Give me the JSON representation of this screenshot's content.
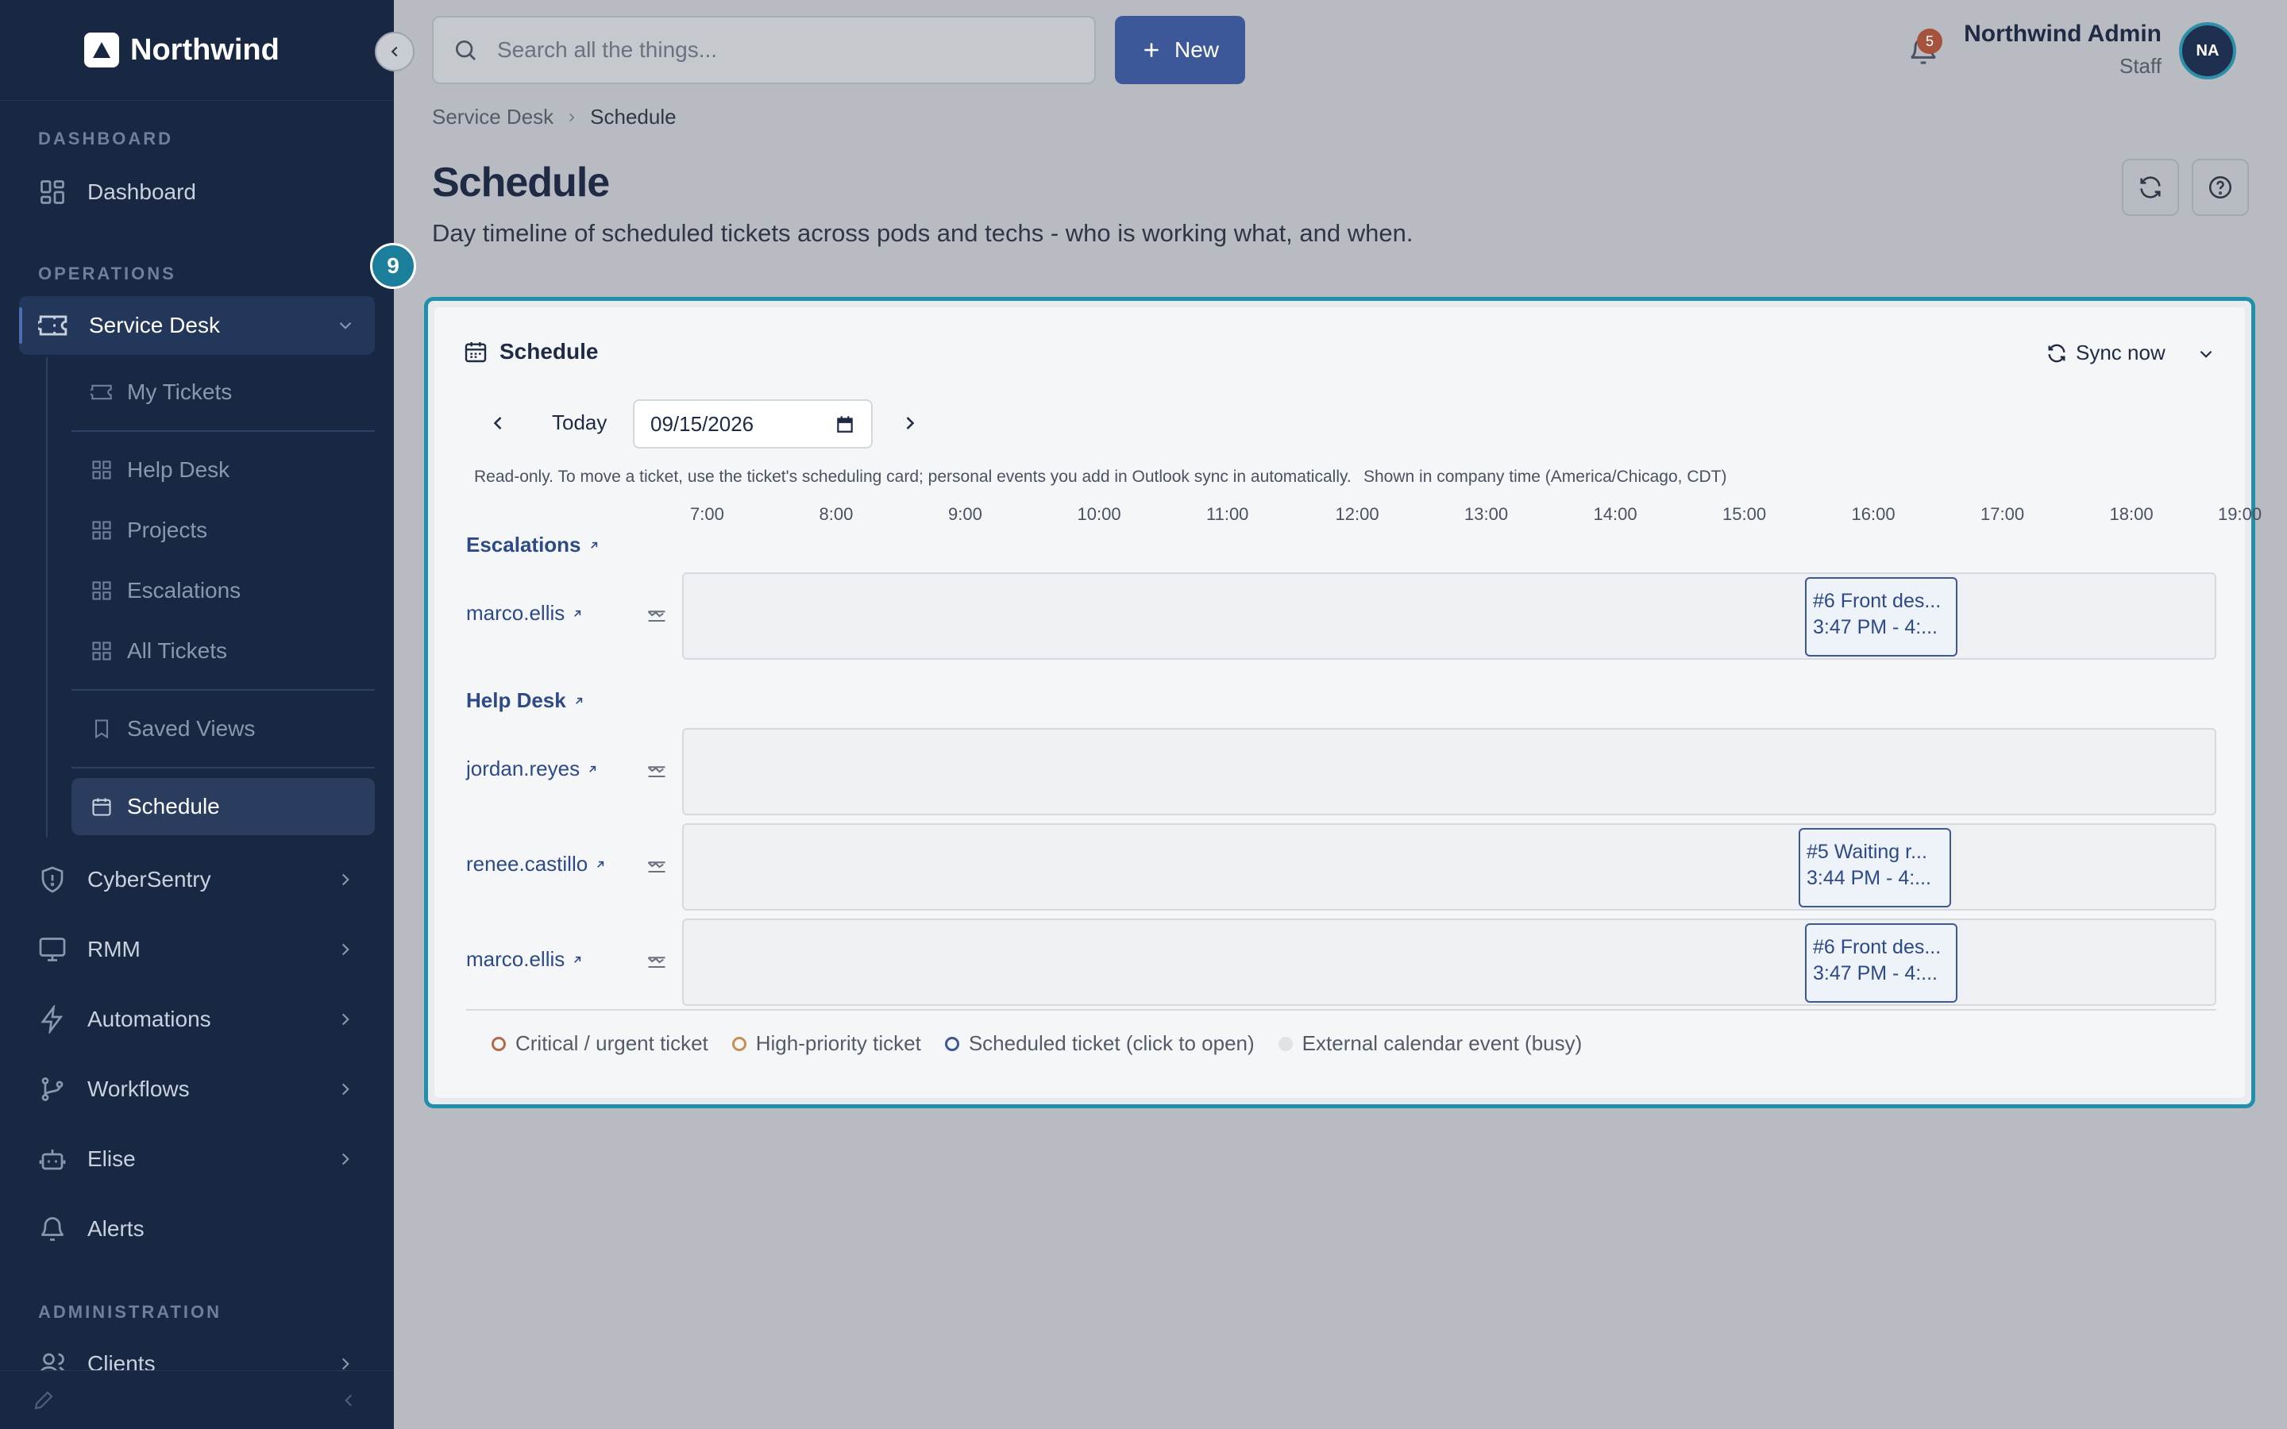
{
  "app": {
    "brand": "Northwind"
  },
  "sidebar": {
    "sections": {
      "dashboard": "DASHBOARD",
      "operations": "OPERATIONS",
      "administration": "ADMINISTRATION"
    },
    "items": {
      "dashboard": "Dashboard",
      "service_desk": "Service Desk",
      "cybersentry": "CyberSentry",
      "rmm": "RMM",
      "automations": "Automations",
      "workflows": "Workflows",
      "elise": "Elise",
      "alerts": "Alerts",
      "clients": "Clients"
    },
    "sub_items": {
      "my_tickets": "My Tickets",
      "help_desk": "Help Desk",
      "projects": "Projects",
      "escalations": "Escalations",
      "all_tickets": "All Tickets",
      "saved_views": "Saved Views",
      "schedule": "Schedule"
    }
  },
  "topbar": {
    "search_placeholder": "Search all the things...",
    "new_label": "New",
    "notification_count": "5",
    "user_name": "Northwind Admin",
    "user_role": "Staff",
    "avatar_initials": "NA"
  },
  "page": {
    "breadcrumb": [
      "Service Desk",
      "Schedule"
    ],
    "title": "Schedule",
    "subtitle": "Day timeline of scheduled tickets across pods and techs - who is working what, and when.",
    "step_badge": "9"
  },
  "schedule": {
    "card_title": "Schedule",
    "sync_label": "Sync now",
    "today_label": "Today",
    "date_value": "09/15/2026",
    "note_readonly": "Read-only. To move a ticket, use the ticket's scheduling card; personal events you add in Outlook sync in automatically.",
    "note_timezone": "Shown in company time (America/Chicago, CDT)",
    "hours": [
      "7:00",
      "8:00",
      "9:00",
      "10:00",
      "11:00",
      "12:00",
      "13:00",
      "14:00",
      "15:00",
      "16:00",
      "17:00",
      "18:00",
      "19:00"
    ],
    "groups": [
      {
        "name": "Escalations",
        "techs": [
          {
            "name": "marco.ellis",
            "events": [
              {
                "title": "#6 Front des...",
                "time": "3:47 PM - 4:..."
              }
            ]
          }
        ]
      },
      {
        "name": "Help Desk",
        "techs": [
          {
            "name": "jordan.reyes",
            "events": []
          },
          {
            "name": "renee.castillo",
            "events": [
              {
                "title": "#5 Waiting r...",
                "time": "3:44 PM - 4:..."
              }
            ]
          },
          {
            "name": "marco.ellis",
            "events": [
              {
                "title": "#6 Front des...",
                "time": "3:47 PM - 4:..."
              }
            ]
          }
        ]
      }
    ],
    "legend": {
      "critical": "Critical / urgent ticket",
      "high": "High-priority ticket",
      "scheduled": "Scheduled ticket (click to open)",
      "external": "External calendar event (busy)"
    }
  },
  "colors": {
    "sidebar_bg": "#182742",
    "accent": "#3c5898",
    "highlight_border": "#1f8fac",
    "link": "#2d4a87"
  }
}
